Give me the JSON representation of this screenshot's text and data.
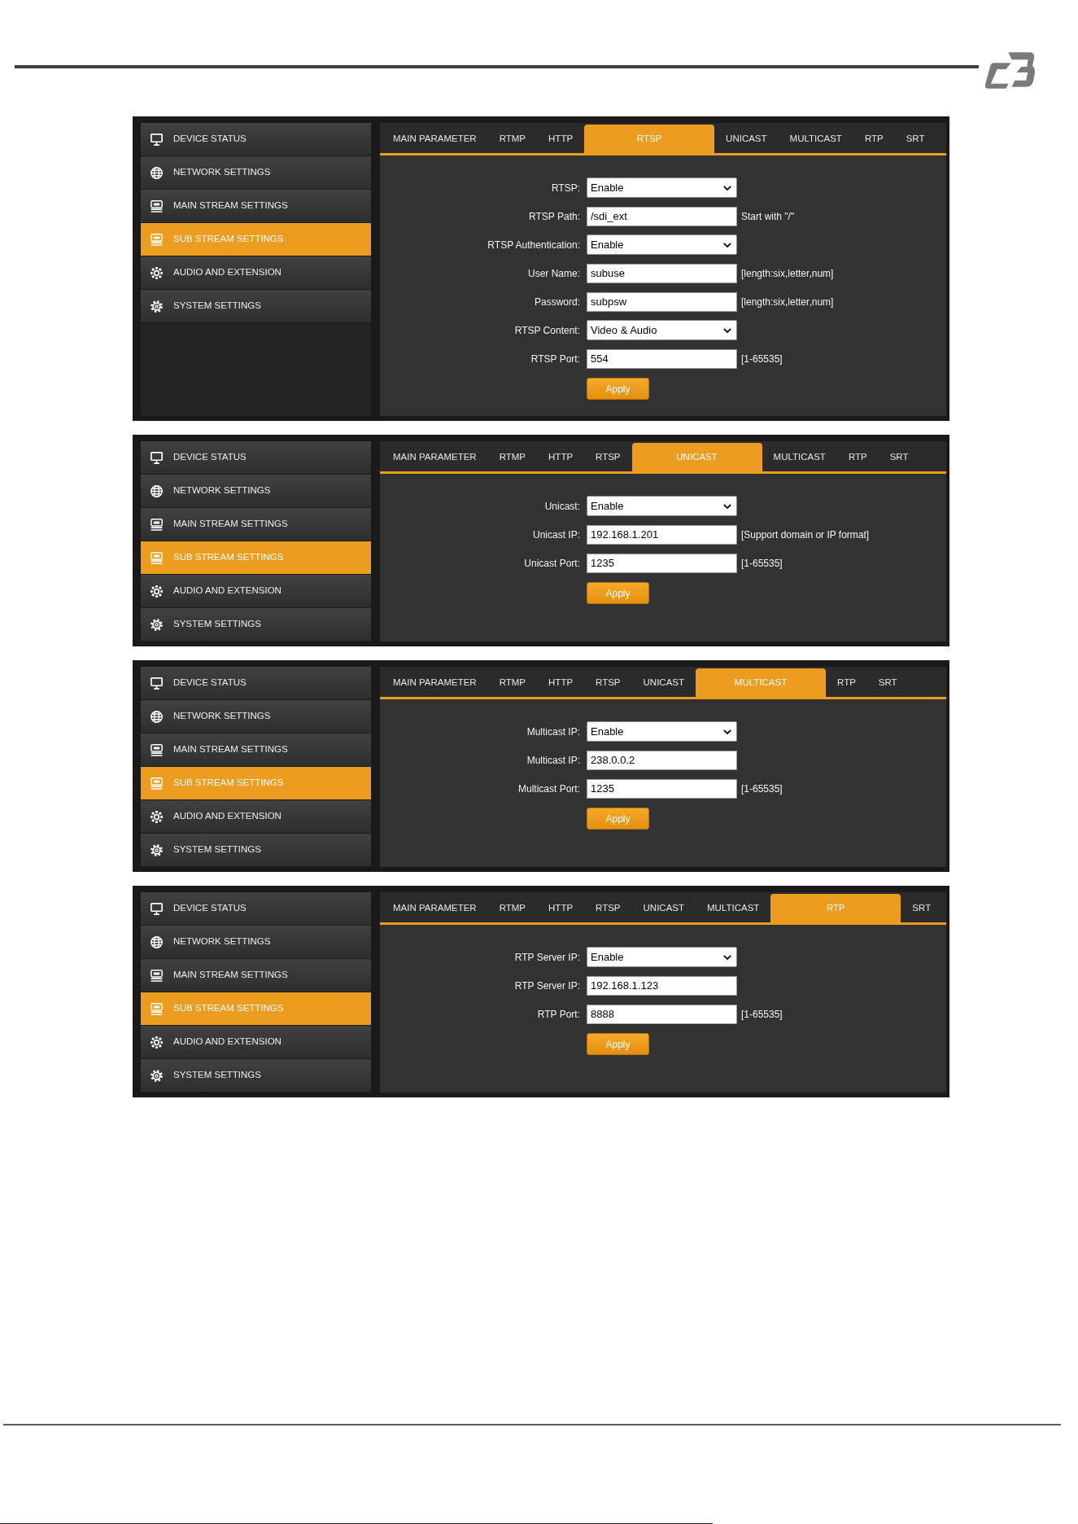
{
  "panels": [
    {
      "sidebar": [
        {
          "label": "DEVICE STATUS",
          "selected": false
        },
        {
          "label": "NETWORK SETTINGS",
          "selected": false
        },
        {
          "label": "MAIN STREAM SETTINGS",
          "selected": false
        },
        {
          "label": "SUB STREAM SETTINGS",
          "selected": true
        },
        {
          "label": "AUDIO AND EXTENSION",
          "selected": false
        },
        {
          "label": "SYSTEM SETTINGS",
          "selected": false
        }
      ],
      "tabs": [
        {
          "label": "MAIN PARAMETER",
          "selected": false
        },
        {
          "label": "RTMP",
          "selected": false
        },
        {
          "label": "HTTP",
          "selected": false
        },
        {
          "label": "RTSP",
          "selected": true
        },
        {
          "label": "UNICAST",
          "selected": false
        },
        {
          "label": "MULTICAST",
          "selected": false
        },
        {
          "label": "RTP",
          "selected": false
        },
        {
          "label": "SRT",
          "selected": false
        }
      ],
      "fields": [
        {
          "kind": "select",
          "label": "RTSP:",
          "value": "Enable"
        },
        {
          "kind": "text",
          "label": "RTSP Path:",
          "value": "/sdi_ext",
          "hint": "Start with \"/\""
        },
        {
          "kind": "select",
          "label": "RTSP Authentication:",
          "value": "Enable"
        },
        {
          "kind": "text",
          "label": "User Name:",
          "value": "subuse",
          "hint": "[length:six,letter,num]"
        },
        {
          "kind": "text",
          "label": "Password:",
          "value": "subpsw",
          "hint": "[length:six,letter,num]"
        },
        {
          "kind": "select",
          "label": "RTSP Content:",
          "value": "Video & Audio"
        },
        {
          "kind": "text",
          "label": "RTSP Port:",
          "value": "554",
          "hint": "[1-65535]"
        }
      ],
      "button": "Apply"
    },
    {
      "sidebar": [
        {
          "label": "DEVICE STATUS",
          "selected": false
        },
        {
          "label": "NETWORK SETTINGS",
          "selected": false
        },
        {
          "label": "MAIN STREAM SETTINGS",
          "selected": false
        },
        {
          "label": "SUB STREAM SETTINGS",
          "selected": true
        },
        {
          "label": "AUDIO AND EXTENSION",
          "selected": false
        },
        {
          "label": "SYSTEM SETTINGS",
          "selected": false
        }
      ],
      "tabs": [
        {
          "label": "MAIN PARAMETER",
          "selected": false
        },
        {
          "label": "RTMP",
          "selected": false
        },
        {
          "label": "HTTP",
          "selected": false
        },
        {
          "label": "RTSP",
          "selected": false
        },
        {
          "label": "UNICAST",
          "selected": true
        },
        {
          "label": "MULTICAST",
          "selected": false
        },
        {
          "label": "RTP",
          "selected": false
        },
        {
          "label": "SRT",
          "selected": false
        }
      ],
      "fields": [
        {
          "kind": "select",
          "label": "Unicast:",
          "value": "Enable"
        },
        {
          "kind": "text",
          "label": "Unicast IP:",
          "value": "192.168.1.201",
          "hint": "[Support domain or IP format]"
        },
        {
          "kind": "text",
          "label": "Unicast Port:",
          "value": "1235",
          "hint": "[1-65535]"
        }
      ],
      "button": "Apply"
    },
    {
      "sidebar": [
        {
          "label": "DEVICE STATUS",
          "selected": false
        },
        {
          "label": "NETWORK SETTINGS",
          "selected": false
        },
        {
          "label": "MAIN STREAM SETTINGS",
          "selected": false
        },
        {
          "label": "SUB STREAM SETTINGS",
          "selected": true
        },
        {
          "label": "AUDIO AND EXTENSION",
          "selected": false
        },
        {
          "label": "SYSTEM SETTINGS",
          "selected": false
        }
      ],
      "tabs": [
        {
          "label": "MAIN PARAMETER",
          "selected": false
        },
        {
          "label": "RTMP",
          "selected": false
        },
        {
          "label": "HTTP",
          "selected": false
        },
        {
          "label": "RTSP",
          "selected": false
        },
        {
          "label": "UNICAST",
          "selected": false
        },
        {
          "label": "MULTICAST",
          "selected": true
        },
        {
          "label": "RTP",
          "selected": false
        },
        {
          "label": "SRT",
          "selected": false
        }
      ],
      "fields": [
        {
          "kind": "select",
          "label": "Multicast IP:",
          "value": "Enable"
        },
        {
          "kind": "text",
          "label": "Multicast IP:",
          "value": "238.0.0.2"
        },
        {
          "kind": "text",
          "label": "Multicast Port:",
          "value": "1235",
          "hint": "[1-65535]"
        }
      ],
      "button": "Apply"
    },
    {
      "sidebar": [
        {
          "label": "DEVICE STATUS",
          "selected": false
        },
        {
          "label": "NETWORK SETTINGS",
          "selected": false
        },
        {
          "label": "MAIN STREAM SETTINGS",
          "selected": false
        },
        {
          "label": "SUB STREAM SETTINGS",
          "selected": true
        },
        {
          "label": "AUDIO AND EXTENSION",
          "selected": false
        },
        {
          "label": "SYSTEM SETTINGS",
          "selected": false
        }
      ],
      "tabs": [
        {
          "label": "MAIN PARAMETER",
          "selected": false
        },
        {
          "label": "RTMP",
          "selected": false
        },
        {
          "label": "HTTP",
          "selected": false
        },
        {
          "label": "RTSP",
          "selected": false
        },
        {
          "label": "UNICAST",
          "selected": false
        },
        {
          "label": "MULTICAST",
          "selected": false
        },
        {
          "label": "RTP",
          "selected": true
        },
        {
          "label": "SRT",
          "selected": false
        }
      ],
      "fields": [
        {
          "kind": "select",
          "label": "RTP Server IP:",
          "value": "Enable"
        },
        {
          "kind": "text",
          "label": "RTP Server IP:",
          "value": "192.168.1.123"
        },
        {
          "kind": "text",
          "label": "RTP Port:",
          "value": "8888",
          "hint": "[1-65535]"
        }
      ],
      "button": "Apply"
    }
  ]
}
